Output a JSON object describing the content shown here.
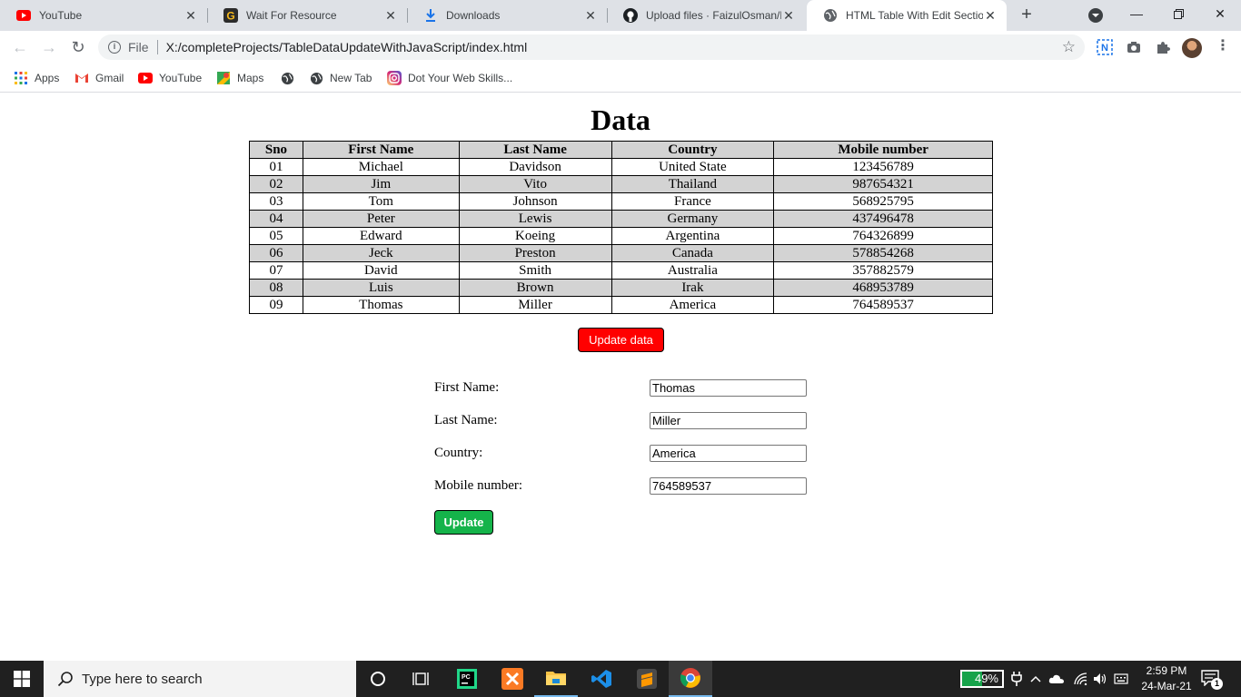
{
  "tabs": [
    {
      "title": "YouTube",
      "icon": "youtube-icon"
    },
    {
      "title": "Wait For Resource",
      "icon": "g-icon"
    },
    {
      "title": "Downloads",
      "icon": "download-icon"
    },
    {
      "title": "Upload files · FaizulOsman/M",
      "icon": "github-icon"
    },
    {
      "title": "HTML Table With Edit Section",
      "icon": "globe-icon",
      "active": true
    }
  ],
  "address_bar": {
    "scheme_label": "File",
    "url": "X:/completeProjects/TableDataUpdateWithJavaScript/index.html"
  },
  "bookmarks": [
    {
      "label": "Apps",
      "icon": "apps-grid-icon"
    },
    {
      "label": "Gmail",
      "icon": "gmail-icon"
    },
    {
      "label": "YouTube",
      "icon": "youtube-icon"
    },
    {
      "label": "Maps",
      "icon": "maps-icon"
    },
    {
      "label": "",
      "icon": "globe-icon"
    },
    {
      "label": "New Tab",
      "icon": "globe-icon"
    },
    {
      "label": "Dot Your Web Skills...",
      "icon": "instagram-icon"
    }
  ],
  "page": {
    "heading": "Data",
    "table": {
      "headers": [
        "Sno",
        "First Name",
        "Last Name",
        "Country",
        "Mobile number"
      ],
      "rows": [
        [
          "01",
          "Michael",
          "Davidson",
          "United State",
          "123456789"
        ],
        [
          "02",
          "Jim",
          "Vito",
          "Thailand",
          "987654321"
        ],
        [
          "03",
          "Tom",
          "Johnson",
          "France",
          "568925795"
        ],
        [
          "04",
          "Peter",
          "Lewis",
          "Germany",
          "437496478"
        ],
        [
          "05",
          "Edward",
          "Koeing",
          "Argentina",
          "764326899"
        ],
        [
          "06",
          "Jeck",
          "Preston",
          "Canada",
          "578854268"
        ],
        [
          "07",
          "David",
          "Smith",
          "Australia",
          "357882579"
        ],
        [
          "08",
          "Luis",
          "Brown",
          "Irak",
          "468953789"
        ],
        [
          "09",
          "Thomas",
          "Miller",
          "America",
          "764589537"
        ]
      ]
    },
    "update_data_button": "Update data",
    "form": {
      "first_name_label": "First Name:",
      "first_name_value": "Thomas",
      "last_name_label": "Last Name:",
      "last_name_value": "Miller",
      "country_label": "Country:",
      "country_value": "America",
      "mobile_label": "Mobile number:",
      "mobile_value": "764589537",
      "update_button": "Update"
    }
  },
  "taskbar": {
    "search_placeholder": "Type here to search",
    "battery_percent": "49%",
    "battery_level": 0.49,
    "time": "2:59 PM",
    "date": "24-Mar-21",
    "notification_count": "1"
  }
}
